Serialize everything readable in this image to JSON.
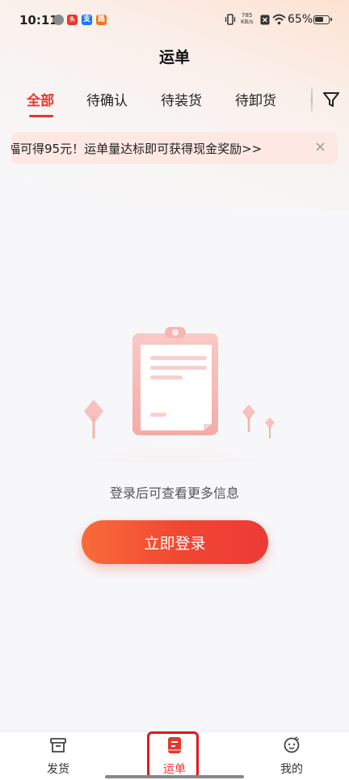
{
  "status_bar": {
    "time": "10:11",
    "app_icons": [
      {
        "name": "weibo-icon",
        "label": "",
        "color": "#8a8a8a"
      },
      {
        "name": "news-app-icon",
        "label": "头条",
        "color": "#e8372c"
      },
      {
        "name": "alipay-icon",
        "label": "支",
        "color": "#1677ff"
      },
      {
        "name": "map-app-icon",
        "label": "路",
        "color": "#f5731f"
      }
    ],
    "net_speed_value": "785",
    "net_speed_unit": "KB/s",
    "battery_percent": "65%",
    "battery_level": 0.65
  },
  "header": {
    "title": "运单"
  },
  "tabs": [
    {
      "label": "全部",
      "active": true
    },
    {
      "label": "待确认",
      "active": false
    },
    {
      "label": "待装货",
      "active": false
    },
    {
      "label": "待卸货",
      "active": false
    }
  ],
  "filter_icon": "filter-icon",
  "notice": {
    "text": "福可得95元！运单量达标即可获得现金奖励>>",
    "close_symbol": "×"
  },
  "empty_state": {
    "message": "登录后可查看更多信息",
    "login_button": "立即登录"
  },
  "bottom_nav": [
    {
      "label": "发货",
      "icon": "archive-box-icon",
      "active": false
    },
    {
      "label": "运单",
      "icon": "waybill-icon",
      "active": true
    },
    {
      "label": "我的",
      "icon": "profile-face-icon",
      "active": false
    }
  ],
  "colors": {
    "accent": "#e8372c",
    "button_gradient_start": "#f86c3a",
    "button_gradient_end": "#ec3a37",
    "notice_bg": "#fde8e3",
    "page_bg": "#f7f7f9"
  }
}
